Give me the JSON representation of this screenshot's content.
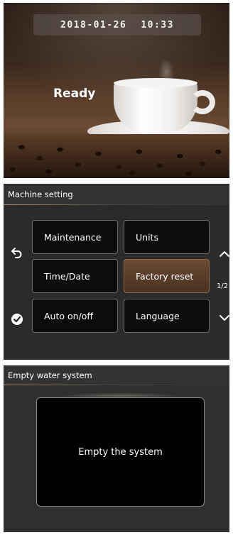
{
  "status_screen": {
    "date": "2018-01-26",
    "time": "10:33",
    "status": "Ready"
  },
  "machine_setting": {
    "title": "Machine setting",
    "tiles": [
      {
        "label": "Maintenance",
        "selected": false
      },
      {
        "label": "Units",
        "selected": false
      },
      {
        "label": "Time/Date",
        "selected": false
      },
      {
        "label": "Factory reset",
        "selected": true
      },
      {
        "label": "Auto on/off",
        "selected": false
      },
      {
        "label": "Language",
        "selected": false
      }
    ],
    "page_indicator": "1/2",
    "icons": {
      "back": "back-arrow-icon",
      "confirm": "checkmark-icon",
      "up": "chevron-up-icon",
      "down": "chevron-down-icon"
    }
  },
  "empty_water": {
    "title": "Empty water system",
    "action_label": "Empty the system"
  },
  "colors": {
    "accent_brown": "#5a3e2a",
    "panel_dark": "#2b2b2b",
    "tile_bg": "#0c0c0c"
  }
}
